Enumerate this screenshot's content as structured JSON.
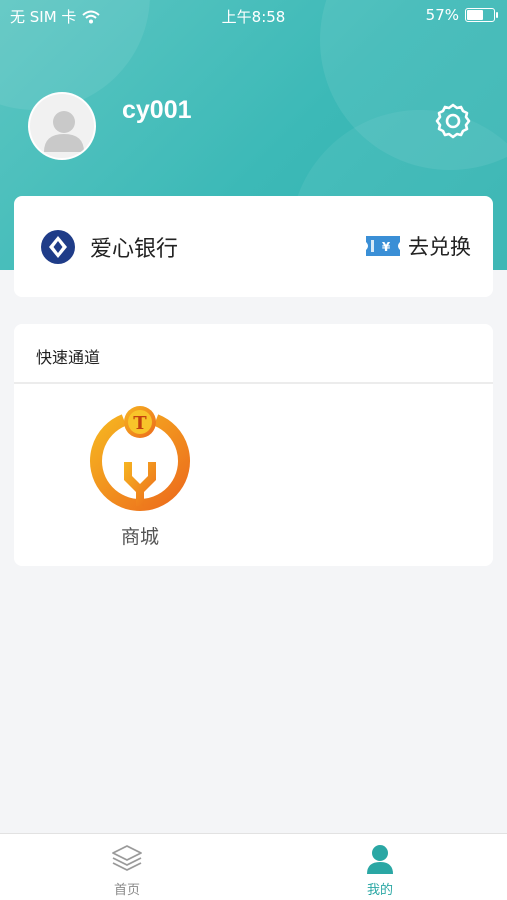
{
  "status_bar": {
    "carrier": "无 SIM 卡",
    "time": "上午8:58",
    "battery_text": "57%",
    "battery_level": 0.57
  },
  "profile": {
    "username": "cy001"
  },
  "bank_card": {
    "name": "爱心银行",
    "exchange_label": "去兑换",
    "exchange_badge": "¥"
  },
  "quick_access": {
    "title": "快速通道",
    "items": [
      {
        "label": "商城",
        "badge": "T"
      }
    ]
  },
  "tabbar": {
    "home_label": "首页",
    "mine_label": "我的",
    "active": "mine"
  },
  "colors": {
    "header": "#3cb9b7",
    "accent": "#2aa7a4",
    "bank_logo": "#1f3c88",
    "exchange_icon": "#3a8fd6",
    "shop_orange": "#f08a1e"
  }
}
